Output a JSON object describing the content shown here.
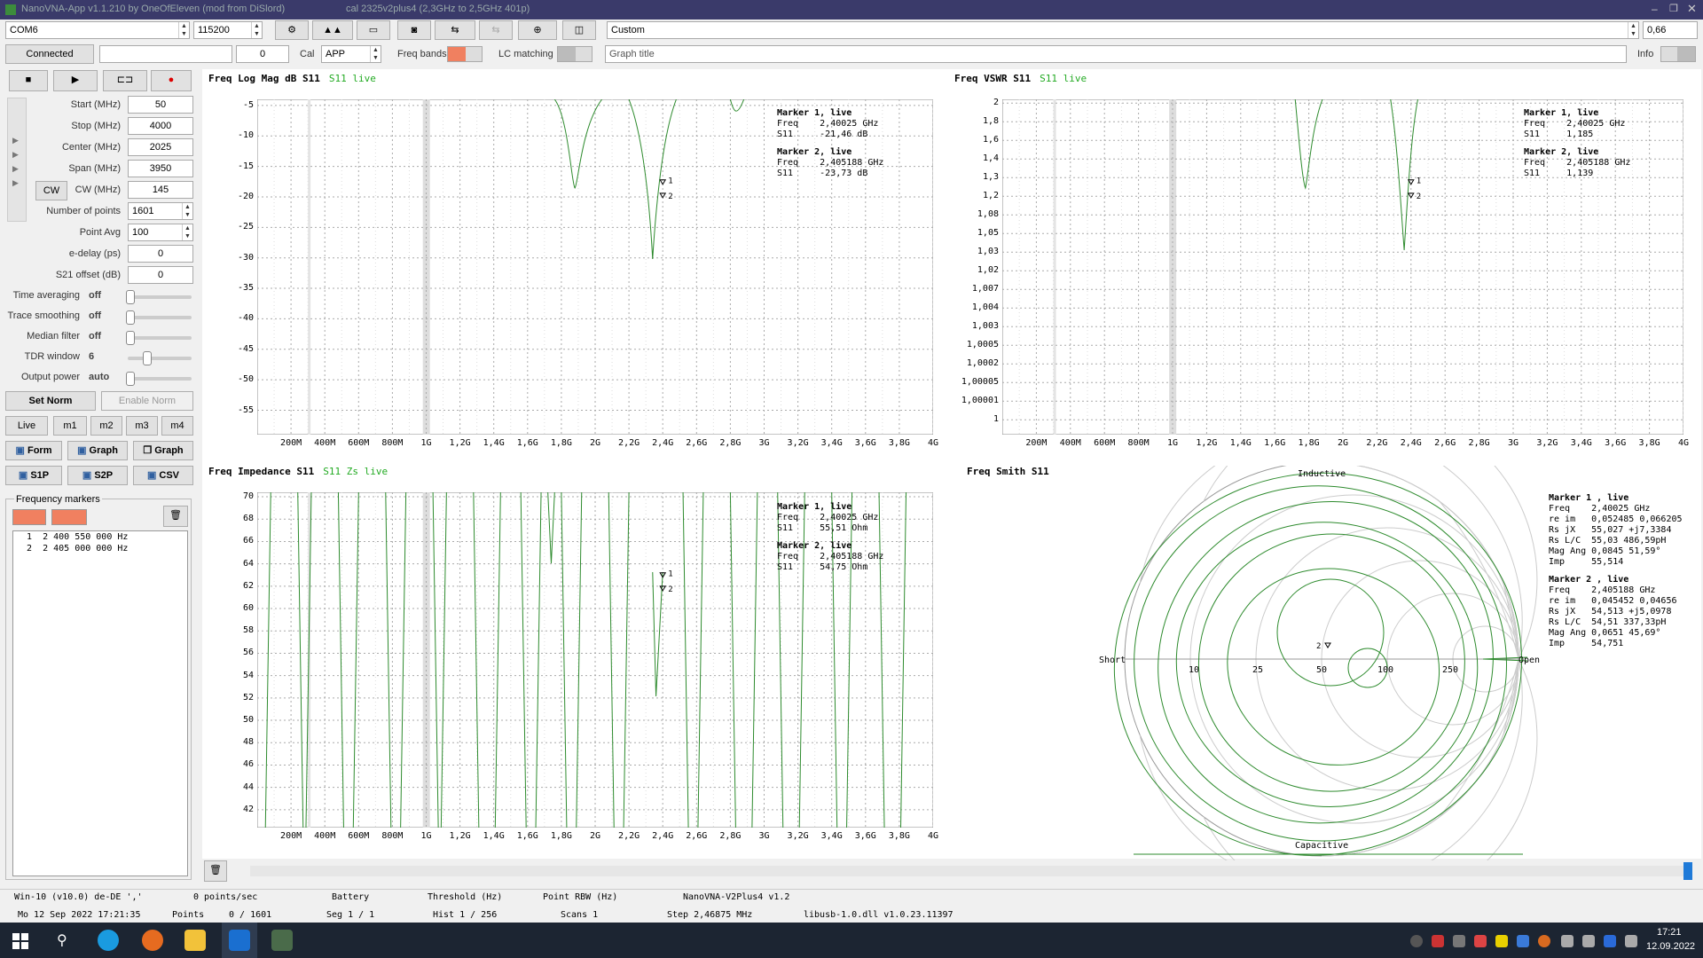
{
  "window": {
    "title": "NanoVNA-App v1.1.210 by OneOfEleven (mod from DiSlord)",
    "subtitle": "cal 2325v2plus4 (2,3GHz to 2,5GHz 401p)"
  },
  "toolbar": {
    "port": "COM6",
    "baud": "115200",
    "preset": "Custom",
    "value_right": "0,66",
    "connected_label": "Connected",
    "counter_value": "0",
    "cal_label": "Cal",
    "cal_value": "APP",
    "freq_bands_label": "Freq bands",
    "lc_matching_label": "LC matching",
    "graph_title_value": "Graph title",
    "info_label": "Info"
  },
  "settings": {
    "start_label": "Start (MHz)",
    "start_value": "50",
    "stop_label": "Stop (MHz)",
    "stop_value": "4000",
    "center_label": "Center (MHz)",
    "center_value": "2025",
    "span_label": "Span (MHz)",
    "span_value": "3950",
    "cw_button": "CW",
    "cw_label": "CW (MHz)",
    "cw_value": "145",
    "points_label": "Number of points",
    "points_value": "1601",
    "avg_label": "Point Avg",
    "avg_value": "100",
    "edelay_label": "e-delay (ps)",
    "edelay_value": "0",
    "s21_label": "S21 offset (dB)",
    "s21_value": "0",
    "sliders": [
      {
        "label": "Time averaging",
        "value": "off",
        "level": 0
      },
      {
        "label": "Trace smoothing",
        "value": "off",
        "level": 0
      },
      {
        "label": "Median filter",
        "value": "off",
        "level": 0
      },
      {
        "label": "TDR window",
        "value": "6",
        "level": 0.3
      },
      {
        "label": "Output power",
        "value": "auto",
        "level": 0
      }
    ],
    "set_norm": "Set Norm",
    "enable_norm": "Enable Norm",
    "mem_tabs": [
      "Live",
      "m1",
      "m2",
      "m3",
      "m4"
    ],
    "save_buttons": [
      "Form",
      "Graph",
      "Graph",
      "S1P",
      "S2P",
      "CSV"
    ],
    "markers_group": "Frequency markers",
    "markers": [
      {
        "num": "1",
        "freq": "2 400 550 000 Hz"
      },
      {
        "num": "2",
        "freq": "2 405 000 000 Hz"
      }
    ]
  },
  "graphs": {
    "logmag": {
      "title": "Freq Log Mag dB S11",
      "live": "S11 live",
      "yticks": [
        "-5",
        "-10",
        "-15",
        "-20",
        "-25",
        "-30",
        "-35",
        "-40",
        "-45",
        "-50",
        "-55"
      ],
      "markers": [
        "Marker 1, live",
        "Freq    2,40025 GHz",
        "S11     -21,46 dB",
        "Marker 2, live",
        "Freq    2,405188 GHz",
        "S11     -23,73 dB"
      ]
    },
    "vswr": {
      "title": "Freq VSWR S11",
      "live": "S11 live",
      "yticks": [
        "2",
        "1,8",
        "1,6",
        "1,4",
        "1,3",
        "1,2",
        "1,08",
        "1,05",
        "1,03",
        "1,02",
        "1,007",
        "1,004",
        "1,003",
        "1,0005",
        "1,0002",
        "1,00005",
        "1,00001",
        "1"
      ],
      "markers": [
        "Marker 1, live",
        "Freq    2,40025 GHz",
        "S11     1,185",
        "Marker 2, live",
        "Freq    2,405188 GHz",
        "S11     1,139"
      ]
    },
    "impedance": {
      "title": "Freq Impedance S11",
      "live": "S11 Zs live",
      "yticks": [
        "70",
        "68",
        "66",
        "64",
        "62",
        "60",
        "58",
        "56",
        "54",
        "52",
        "50",
        "48",
        "46",
        "44",
        "42"
      ],
      "markers": [
        "Marker 1, live",
        "Freq    2,40025 GHz",
        "S11     55,51 Ohm",
        "Marker 2, live",
        "Freq    2,405188 GHz",
        "S11     54,75 Ohm"
      ]
    },
    "smith": {
      "title": "Freq Smith S11",
      "labels": {
        "inductive": "Inductive",
        "capacitive": "Capacitive",
        "short": "Short",
        "open": "Open",
        "r10": "10",
        "r25": "25",
        "r50": "50",
        "r100": "100",
        "r250": "250"
      },
      "markers": [
        "Marker 1 , live",
        "Freq    2,40025 GHz",
        "re im   0,052485 0,066205",
        "Rs jX   55,027 +j7,3384",
        "Rs L/C  55,03 486,59pH",
        "Mag Ang 0,0845 51,59°",
        "Imp     55,514",
        "Marker 2 , live",
        "Freq    2,405188 GHz",
        "re im   0,045452 0,04656",
        "Rs jX   54,513 +j5,0978",
        "Rs L/C  54,51 337,33pH",
        "Mag Ang 0,0651 45,69°",
        "Imp     54,751"
      ]
    },
    "xticks": [
      "200M",
      "400M",
      "600M",
      "800M",
      "1G",
      "1,2G",
      "1,4G",
      "1,6G",
      "1,8G",
      "2G",
      "2,2G",
      "2,4G",
      "2,6G",
      "2,8G",
      "3G",
      "3,2G",
      "3,4G",
      "3,6G",
      "3,8G",
      "4G"
    ]
  },
  "status": {
    "os": "Win-10 (v10.0) de-DE ',' ",
    "date": "Mo 12 Sep 2022 17:21:35",
    "pps": "0 points/sec",
    "points_label": "Points",
    "points_value": "0 / 1601",
    "battery": "Battery",
    "seg": "Seg 1 / 1",
    "threshold": "Threshold (Hz)",
    "hist": "Hist 1 / 256",
    "rbw": "Point RBW (Hz)",
    "scans": "Scans 1",
    "device": "NanoVNA-V2Plus4 v1.2",
    "step": "Step 2,46875 MHz",
    "lib": "libusb-1.0.dll v1.0.23.11397"
  },
  "taskbar": {
    "time": "17:21",
    "date": "12.09.2022"
  },
  "colors": {
    "trace": "#2e8b2e",
    "live": "#22aa22",
    "accent": "#f08060"
  }
}
